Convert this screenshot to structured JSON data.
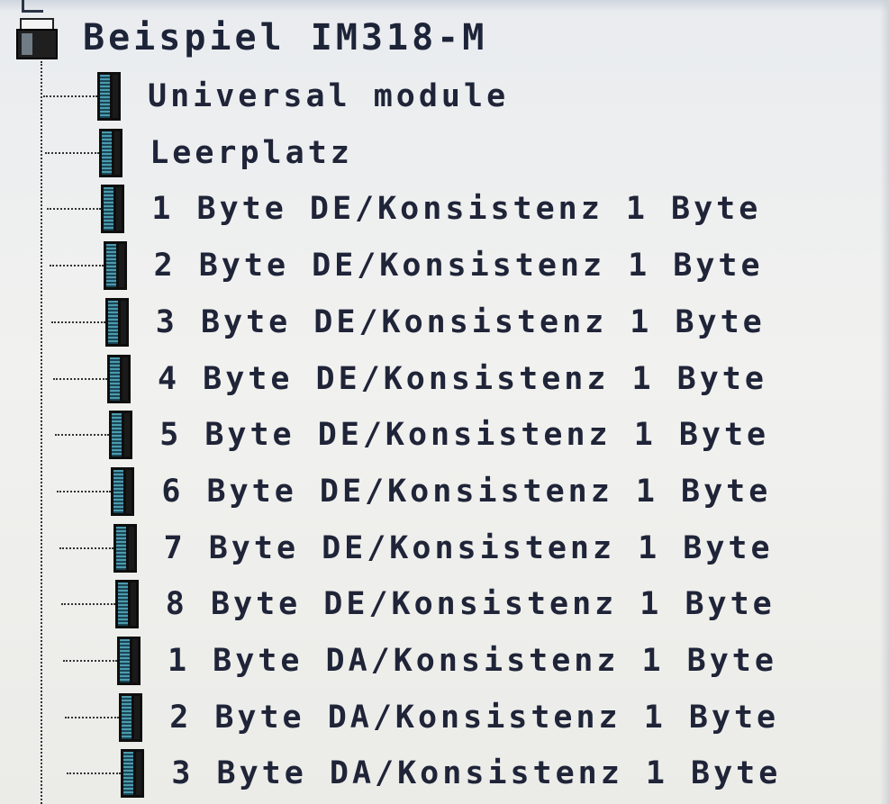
{
  "tree": {
    "root": {
      "label": "Beispiel IM318-M",
      "icon": "station-folder-icon"
    },
    "items": [
      {
        "label": "Universal module",
        "icon": "module-icon"
      },
      {
        "label": "Leerplatz",
        "icon": "module-icon"
      },
      {
        "label": "1 Byte DE/Konsistenz 1 Byte",
        "icon": "module-icon"
      },
      {
        "label": "2 Byte DE/Konsistenz 1 Byte",
        "icon": "module-icon"
      },
      {
        "label": "3 Byte DE/Konsistenz 1 Byte",
        "icon": "module-icon"
      },
      {
        "label": "4 Byte DE/Konsistenz 1 Byte",
        "icon": "module-icon"
      },
      {
        "label": "5 Byte DE/Konsistenz 1 Byte",
        "icon": "module-icon"
      },
      {
        "label": "6 Byte DE/Konsistenz 1 Byte",
        "icon": "module-icon"
      },
      {
        "label": "7 Byte DE/Konsistenz 1 Byte",
        "icon": "module-icon"
      },
      {
        "label": "8 Byte DE/Konsistenz 1 Byte",
        "icon": "module-icon"
      },
      {
        "label": "1 Byte DA/Konsistenz 1 Byte",
        "icon": "module-icon"
      },
      {
        "label": "2 Byte DA/Konsistenz 1 Byte",
        "icon": "module-icon"
      },
      {
        "label": "3 Byte DA/Konsistenz 1 Byte",
        "icon": "module-icon"
      }
    ]
  },
  "colors": {
    "text": "#1f2438",
    "background": "#eeeeec",
    "icon_dark": "#0e0e0e",
    "icon_accent": "#4c9bb0"
  }
}
